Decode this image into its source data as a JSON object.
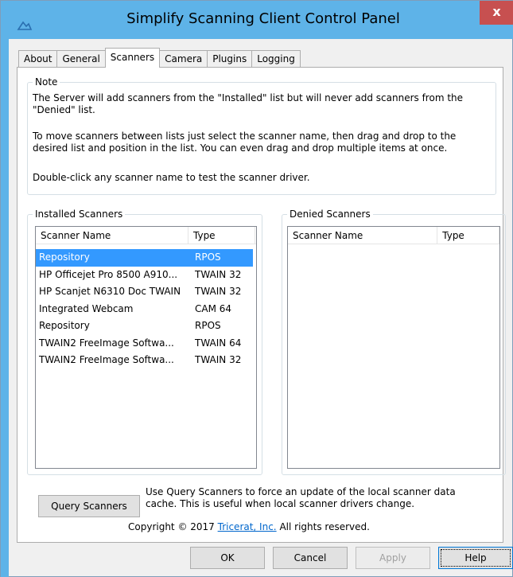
{
  "window": {
    "title": "Simplify Scanning Client Control Panel",
    "close_label": "x"
  },
  "tabs": [
    {
      "label": "About"
    },
    {
      "label": "General"
    },
    {
      "label": "Scanners"
    },
    {
      "label": "Camera"
    },
    {
      "label": "Plugins"
    },
    {
      "label": "Logging"
    }
  ],
  "active_tab": "Scanners",
  "note": {
    "title": "Note",
    "line1": "The Server will add scanners from the \"Installed\" list but will never add scanners from the \"Denied\" list.",
    "line2": "To move scanners between lists just select the scanner name, then drag and drop to the desired list and position in the list.  You can even drag and drop multiple items at once.",
    "line3": "Double-click any scanner name to test the scanner driver."
  },
  "installed": {
    "title": "Installed Scanners",
    "col_name": "Scanner Name",
    "col_type": "Type",
    "rows": [
      {
        "name": "Repository",
        "type": "RPOS"
      },
      {
        "name": "HP Officejet Pro 8500 A910...",
        "type": "TWAIN 32"
      },
      {
        "name": "HP Scanjet N6310 Doc TWAIN",
        "type": "TWAIN 32"
      },
      {
        "name": "Integrated Webcam",
        "type": "CAM 64"
      },
      {
        "name": "Repository",
        "type": "RPOS"
      },
      {
        "name": "TWAIN2 FreeImage Softwa...",
        "type": "TWAIN 64"
      },
      {
        "name": "TWAIN2 FreeImage Softwa...",
        "type": "TWAIN 32"
      }
    ]
  },
  "denied": {
    "title": "Denied Scanners",
    "col_name": "Scanner Name",
    "col_type": "Type"
  },
  "query": {
    "button_label": "Query Scanners",
    "description": "Use Query Scanners to force an update of the local scanner data cache.  This is useful when local scanner drivers change."
  },
  "copyright": {
    "prefix": "Copyright © 2017 ",
    "link": "Tricerat, Inc.",
    "suffix": " All rights reserved."
  },
  "buttons": {
    "ok": "OK",
    "cancel": "Cancel",
    "apply": "Apply",
    "help": "Help"
  },
  "colors": {
    "titlebar": "#5eb3e8",
    "close": "#c75050",
    "selection": "#3399ff",
    "link": "#0066cc"
  }
}
